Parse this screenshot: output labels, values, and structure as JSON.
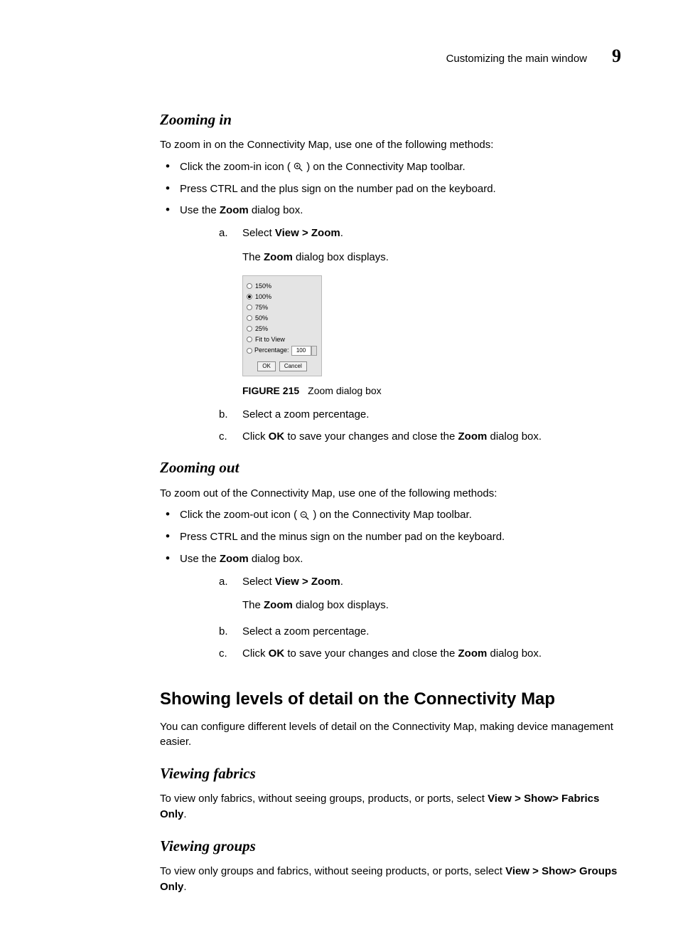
{
  "header": {
    "running_title": "Customizing the main window",
    "chapter_number": "9"
  },
  "zooming_in": {
    "heading": "Zooming in",
    "intro": "To zoom in on the Connectivity Map, use one of the following methods:",
    "bullets": [
      {
        "pre": "Click the zoom-in icon (",
        "icon": "zoom-in-icon",
        "post": ") on the Connectivity Map toolbar."
      },
      {
        "full": "Press CTRL and the plus sign on the number pad on the keyboard."
      },
      {
        "pre": "Use the ",
        "bold": "Zoom",
        "post": " dialog box."
      }
    ],
    "steps": {
      "a": {
        "pre": "Select ",
        "bold": "View > Zoom",
        "post": "."
      },
      "a_result_pre": "The ",
      "a_result_bold": "Zoom",
      "a_result_post": " dialog box displays.",
      "b": "Select a zoom percentage.",
      "c": {
        "pre": "Click ",
        "bold1": "OK",
        "mid": " to save your changes and close the ",
        "bold2": "Zoom",
        "post": " dialog box."
      }
    }
  },
  "figure": {
    "number": "FIGURE 215",
    "caption": "Zoom dialog box",
    "dialog": {
      "options": [
        "150%",
        "100%",
        "75%",
        "50%",
        "25%",
        "Fit to View"
      ],
      "selected_index": 1,
      "percentage_label": "Percentage:",
      "percentage_value": "100",
      "ok": "OK",
      "cancel": "Cancel"
    }
  },
  "zooming_out": {
    "heading": "Zooming out",
    "intro": "To zoom out of the Connectivity Map, use one of the following methods:",
    "bullets": [
      {
        "pre": "Click the zoom-out icon (",
        "icon": "zoom-out-icon",
        "post": ") on the Connectivity Map toolbar."
      },
      {
        "full": "Press CTRL and the minus sign on the number pad on the keyboard."
      },
      {
        "pre": "Use the ",
        "bold": "Zoom",
        "post": " dialog box."
      }
    ],
    "steps": {
      "a": {
        "pre": "Select ",
        "bold": "View > Zoom",
        "post": "."
      },
      "a_result_pre": "The ",
      "a_result_bold": "Zoom",
      "a_result_post": " dialog box displays.",
      "b": "Select a zoom percentage.",
      "c": {
        "pre": "Click ",
        "bold1": "OK",
        "mid": " to save your changes and close the ",
        "bold2": "Zoom",
        "post": " dialog box."
      }
    }
  },
  "levels": {
    "heading": "Showing levels of detail on the Connectivity Map",
    "intro": "You can configure different levels of detail on the Connectivity Map, making device management easier."
  },
  "fabrics": {
    "heading": "Viewing fabrics",
    "text_pre": "To view only fabrics, without seeing groups, products, or ports, select ",
    "text_bold": "View > Show> Fabrics Only",
    "text_post": "."
  },
  "groups": {
    "heading": "Viewing groups",
    "text_pre": "To view only groups and fabrics, without seeing products, or ports, select ",
    "text_bold": "View > Show> Groups Only",
    "text_post": "."
  }
}
